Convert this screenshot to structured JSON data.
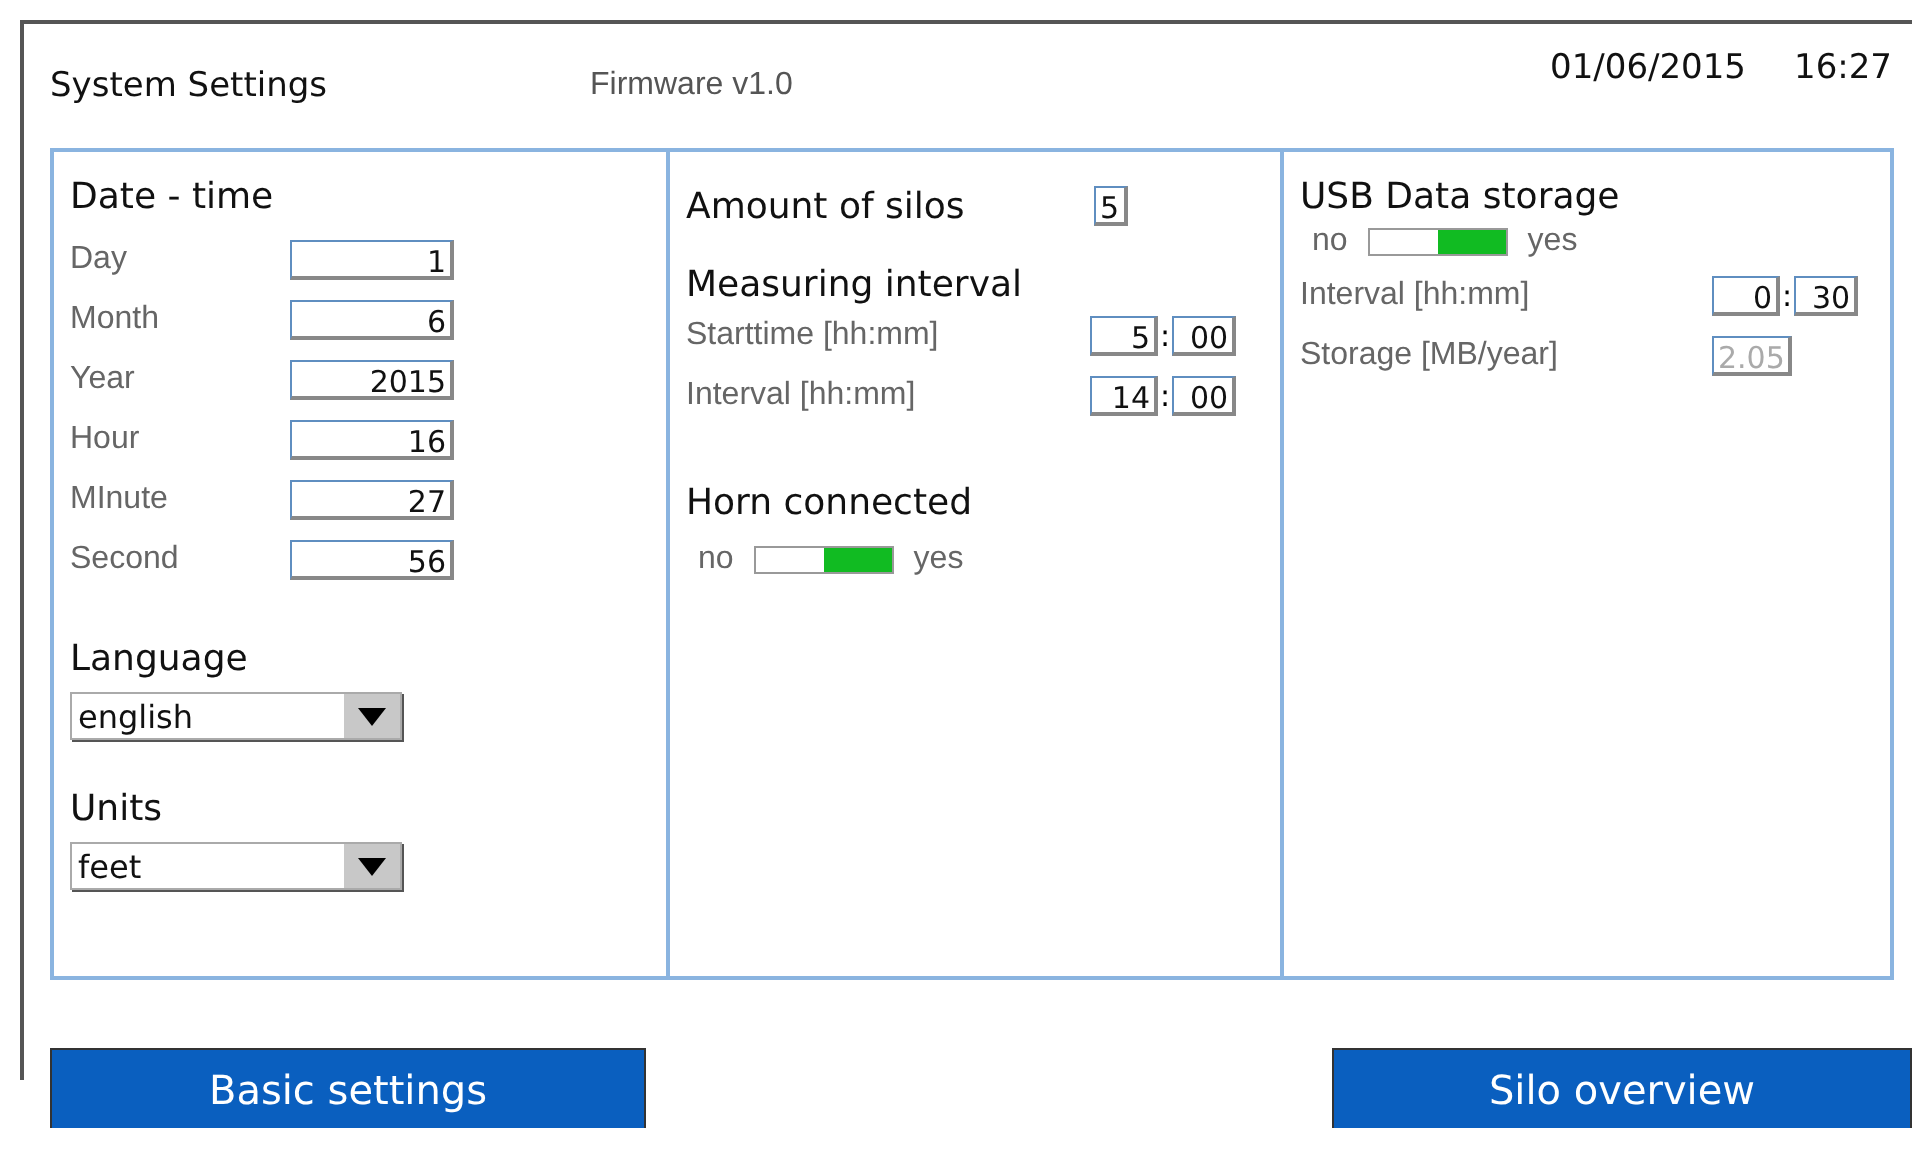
{
  "header": {
    "title": "System Settings",
    "firmware": "Firmware v1.0",
    "date": "01/06/2015",
    "time": "16:27"
  },
  "date_time": {
    "title": "Date - time",
    "fields": [
      {
        "label": "Day",
        "value": "1"
      },
      {
        "label": "Month",
        "value": "6"
      },
      {
        "label": "Year",
        "value": "2015"
      },
      {
        "label": "Hour",
        "value": "16"
      },
      {
        "label": "MInute",
        "value": "27"
      },
      {
        "label": "Second",
        "value": "56"
      }
    ]
  },
  "language": {
    "title": "Language",
    "value": "english"
  },
  "units": {
    "title": "Units",
    "value": "feet"
  },
  "silos": {
    "label": "Amount of silos",
    "value": "5"
  },
  "measuring": {
    "title": "Measuring interval",
    "rows": [
      {
        "label": "Starttime [hh:mm]",
        "hours": "5",
        "separator": ":",
        "minutes": "00"
      },
      {
        "label": "Interval [hh:mm]",
        "hours": "14",
        "separator": ":",
        "minutes": "00"
      }
    ]
  },
  "horn": {
    "title": "Horn connected",
    "off_label": "no",
    "on_label": "yes",
    "on": true
  },
  "usb": {
    "title": "USB Data storage",
    "off_label": "no",
    "on_label": "yes",
    "on": true,
    "interval": {
      "label": "Interval [hh:mm]",
      "hours": "0",
      "separator": ":",
      "minutes": "30"
    },
    "storage": {
      "label": "Storage [MB/year]",
      "value": "2.05",
      "disabled": true
    }
  },
  "buttons": [
    "Basic settings",
    "Silo overview"
  ]
}
